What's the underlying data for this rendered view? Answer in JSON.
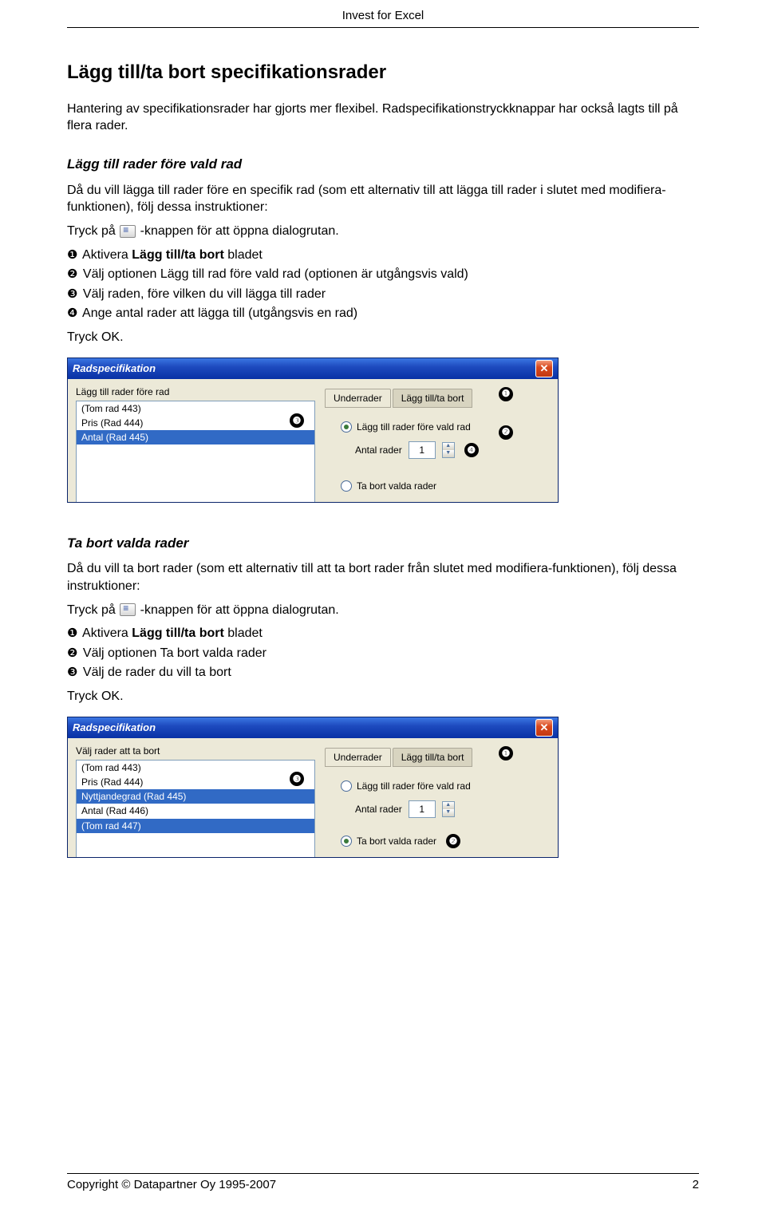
{
  "header": {
    "product": "Invest for Excel"
  },
  "main": {
    "title": "Lägg till/ta bort specifikationsrader",
    "intro": "Hantering av specifikationsrader har gjorts mer flexibel. Radspecifikationstryckknappar har också lagts till på flera rader.",
    "sec1": {
      "heading": "Lägg till rader före vald rad",
      "para": "Då du vill lägga till rader före en specifik rad (som ett alternativ till att lägga till rader i slutet med modifiera-funktionen), följ dessa instruktioner:",
      "press_a": "Tryck på ",
      "press_b": " -knappen för att öppna dialogrutan.",
      "s1a": "Aktivera ",
      "s1bold": "Lägg till/ta bort",
      "s1b": " bladet",
      "s2": "Välj optionen Lägg till rad före vald rad (optionen är utgångsvis vald)",
      "s3": "Välj raden, före vilken du vill lägga till rader",
      "s4": "Ange antal rader att lägga till (utgångsvis en rad)",
      "ok": "Tryck OK."
    },
    "sec2": {
      "heading": "Ta bort valda rader",
      "para": "Då du vill ta bort rader (som ett alternativ till att ta bort rader från slutet med modifiera-funktionen), följ dessa instruktioner:",
      "press_a": "Tryck på ",
      "press_b": " -knappen för att öppna dialogrutan.",
      "s1a": "Aktivera ",
      "s1bold": "Lägg till/ta bort",
      "s1b": " bladet",
      "s2": "Välj optionen Ta bort valda rader",
      "s3": "Välj de rader du vill ta bort",
      "ok": "Tryck OK."
    }
  },
  "dialog1": {
    "title": "Radspecifikation",
    "left_label": "Lägg till rader före rad",
    "items": [
      "(Tom rad 443)",
      "Pris (Rad 444)",
      "Antal (Rad 445)"
    ],
    "sel_index": 2,
    "tabs": {
      "a": "Underrader",
      "b": "Lägg till/ta bort"
    },
    "opt1": "Lägg till rader före vald rad",
    "antal_label": "Antal rader",
    "antal_value": "1",
    "opt2": "Ta bort valda rader",
    "checked": 1
  },
  "dialog2": {
    "title": "Radspecifikation",
    "left_label": "Välj rader att ta bort",
    "items": [
      "(Tom rad 443)",
      "Pris (Rad 444)",
      "Nyttjandegrad (Rad 445)",
      "Antal (Rad 446)",
      "(Tom rad 447)"
    ],
    "sel": [
      2,
      4
    ],
    "tabs": {
      "a": "Underrader",
      "b": "Lägg till/ta bort"
    },
    "opt1": "Lägg till rader före vald rad",
    "antal_label": "Antal rader",
    "antal_value": "1",
    "opt2": "Ta bort valda rader",
    "checked": 2
  },
  "bullets": {
    "b1": "❶",
    "b2": "❷",
    "b3": "❸",
    "b4": "❹"
  },
  "footer": {
    "copyright": "Copyright © Datapartner Oy 1995-2007",
    "page": "2"
  }
}
